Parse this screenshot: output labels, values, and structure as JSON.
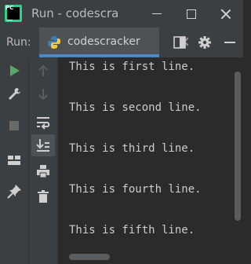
{
  "window": {
    "title": "Run - codescra",
    "logo_text": "PC"
  },
  "run_panel": {
    "label": "Run:",
    "tab_label": "codescracker"
  },
  "icons": {
    "logo": "pycharm-logo-icon",
    "tab": "python-file-icon",
    "rerun": "rerun-icon",
    "settings": "gear-icon",
    "hide": "minimize-panel-icon",
    "layout": "layout-icon",
    "run": "play-icon",
    "modify": "wrench-icon",
    "stop": "stop-icon",
    "restore": "restore-layout-icon",
    "pin": "pin-icon",
    "up": "arrow-up-icon",
    "down": "arrow-down-icon",
    "wrap": "soft-wrap-icon",
    "scroll_end": "scroll-to-end-icon",
    "print": "print-icon",
    "delete": "trash-icon"
  },
  "console": {
    "lines": [
      "This is first line.",
      "This is second line.",
      "This is third line.",
      "This is fourth line.",
      "This is fifth line."
    ]
  },
  "colors": {
    "background": "#2b2b2b",
    "panel": "#3c3f41",
    "tab_active": "#4e5254",
    "accent": "#4a88c7",
    "run_green": "#59a869",
    "text": "#cccccc",
    "logo_green": "#21d789"
  }
}
